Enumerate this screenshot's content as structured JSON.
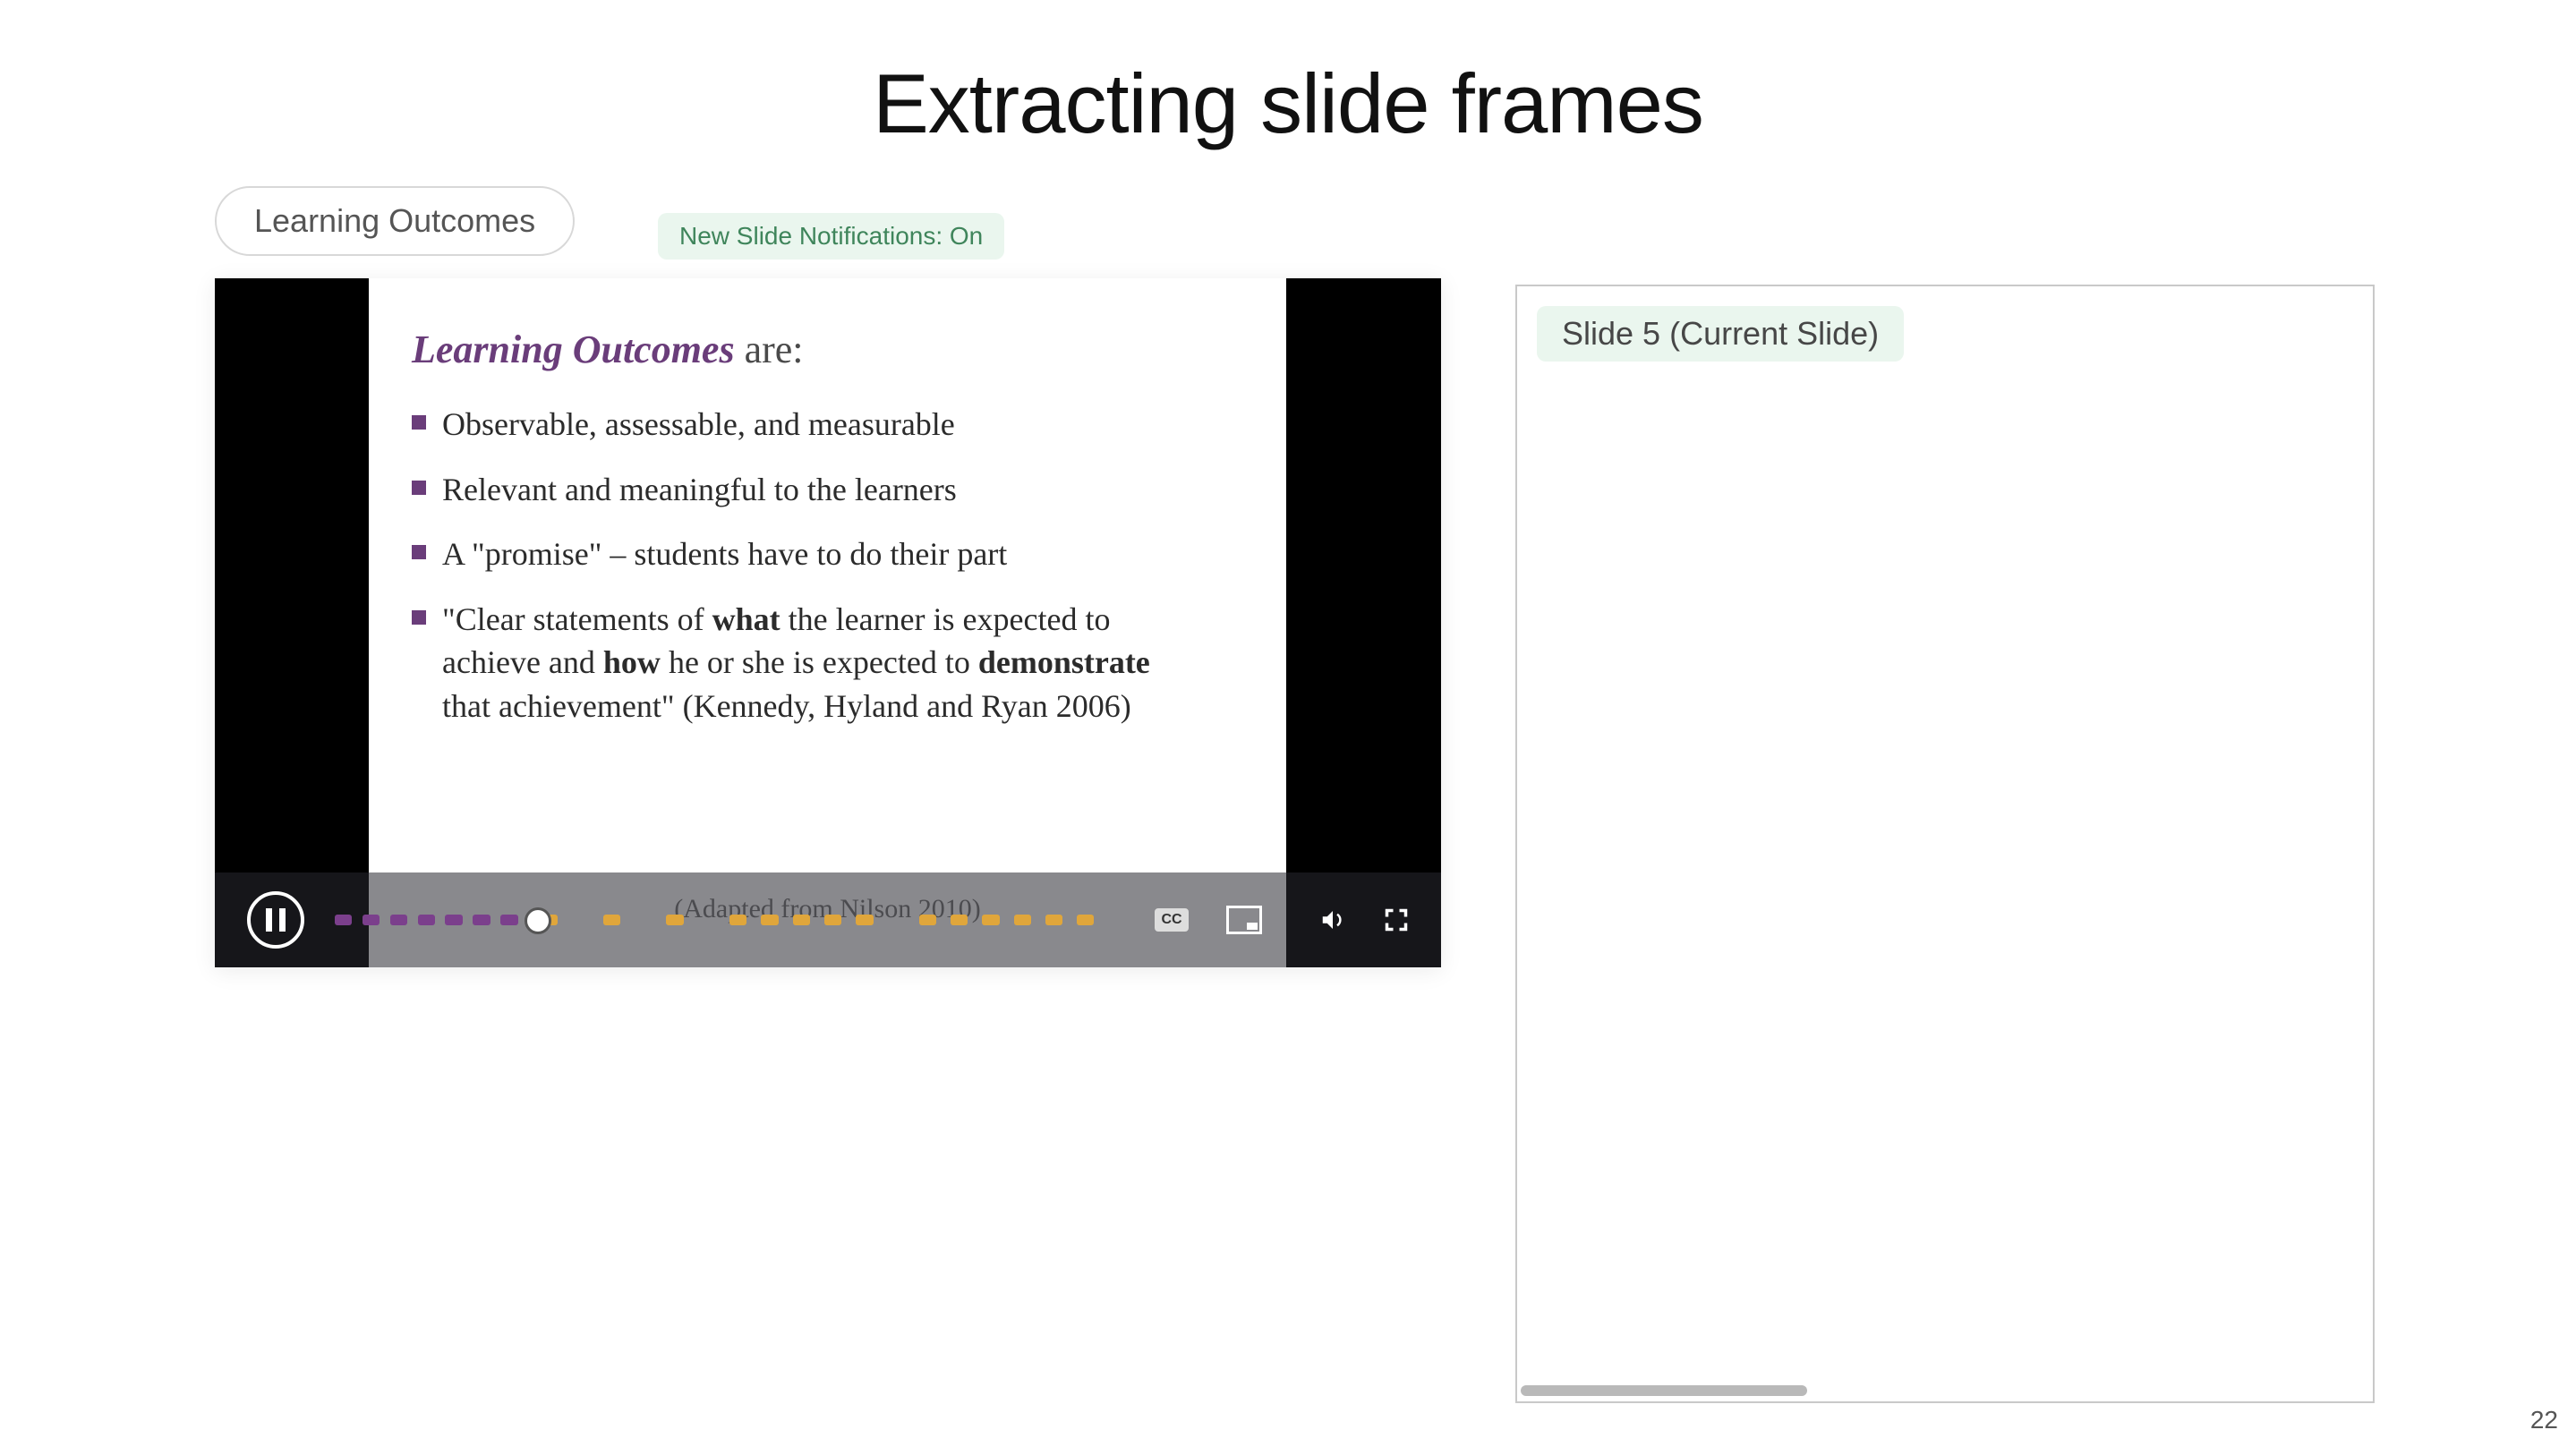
{
  "page": {
    "title": "Extracting slide frames",
    "number": "22"
  },
  "leftPanel": {
    "pillLabel": "Learning Outcomes",
    "notification": "New Slide Notifications: On"
  },
  "slideInVideo": {
    "headingItalic": "Learning Outcomes",
    "headingRest": " are:",
    "bulletsHtml": [
      "Observable, assessable, and measurable",
      "Relevant and meaningful to the learners",
      "A \"promise\" – students have to do their part",
      "\"Clear statements of <b>what</b> the learner is expected to achieve and <b>how</b> he or she is expected to <b>demonstrate</b> that achievement\" (Kennedy, Hyland and Ryan 2006)"
    ],
    "footer": "(Adapted from Nilson 2010)"
  },
  "player": {
    "ccLabel": "CC",
    "progressPercent": 24,
    "dashesPlayed": [
      0,
      3.5,
      7,
      10.5,
      14,
      17.5,
      21
    ],
    "dashesFuture": [
      26,
      34,
      42,
      50,
      54,
      58,
      62,
      66,
      74,
      78,
      82,
      86,
      90,
      94
    ]
  },
  "rightPanel": {
    "chip": "Slide 5 (Current Slide)"
  }
}
